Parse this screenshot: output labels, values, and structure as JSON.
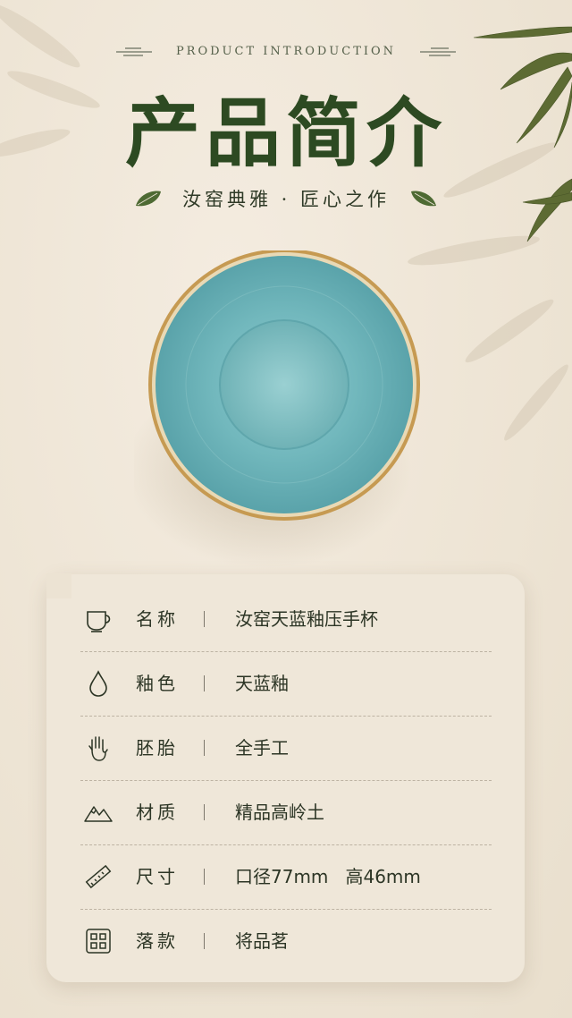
{
  "header": {
    "subtitle_en": "PRODUCT INTRODUCTION",
    "title_cn": "产品简介",
    "tagline": "汝窑典雅 · 匠心之作"
  },
  "product_image": {
    "name": "bowl-top-view",
    "glaze_color": "#6fb3b8",
    "rim_color": "#c69a52"
  },
  "specs": [
    {
      "icon": "cup-icon",
      "label": "名称",
      "value": "汝窑天蓝釉压手杯"
    },
    {
      "icon": "drop-icon",
      "label": "釉色",
      "value": "天蓝釉"
    },
    {
      "icon": "hand-icon",
      "label": "胚胎",
      "value": "全手工"
    },
    {
      "icon": "mountain-icon",
      "label": "材质",
      "value": "精品高岭土"
    },
    {
      "icon": "ruler-icon",
      "label": "尺寸",
      "value": "口径77mm   高46mm"
    },
    {
      "icon": "seal-icon",
      "label": "落款",
      "value": "将品茗"
    }
  ],
  "colors": {
    "title_green": "#2d4a22",
    "background": "#efe6d7",
    "card": "#efe7d9"
  }
}
